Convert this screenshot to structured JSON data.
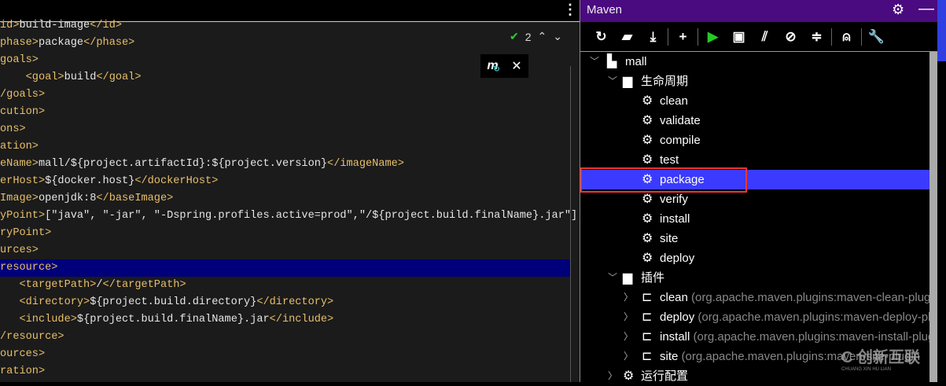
{
  "editor": {
    "inspection_count": "2",
    "code_lines": [
      [
        [
          "tag",
          "id>"
        ],
        [
          "text",
          "build-image"
        ],
        [
          "tag",
          "</id>"
        ]
      ],
      [
        [
          "tag",
          "phase>"
        ],
        [
          "text",
          "package"
        ],
        [
          "tag",
          "</phase>"
        ]
      ],
      [
        [
          "tag",
          "goals>"
        ]
      ],
      [
        [
          "tag",
          "    <goal>"
        ],
        [
          "text",
          "build"
        ],
        [
          "tag",
          "</goal>"
        ]
      ],
      [
        [
          "tag",
          "/goals>"
        ]
      ],
      [
        [
          "tag",
          "cution>"
        ]
      ],
      [
        [
          "tag",
          "ons>"
        ]
      ],
      [
        [
          "tag",
          "ation>"
        ]
      ],
      [
        [
          "tag",
          "eName>"
        ],
        [
          "text",
          "mall/${project.artifactId}:${project.version}"
        ],
        [
          "tag",
          "</imageName>"
        ]
      ],
      [
        [
          "tag",
          "erHost>"
        ],
        [
          "text",
          "${docker.host}"
        ],
        [
          "tag",
          "</dockerHost>"
        ]
      ],
      [
        [
          "tag",
          "Image>"
        ],
        [
          "text",
          "openjdk:8"
        ],
        [
          "tag",
          "</baseImage>"
        ]
      ],
      [
        [
          "tag",
          "yPoint>"
        ],
        [
          "text",
          "[\"java\", \"-jar\", \"-Dspring.profiles.active=prod\",\"/${project.build.finalName}.jar\"]"
        ]
      ],
      [
        [
          "tag",
          "ryPoint>"
        ]
      ],
      [
        [
          "tag",
          "urces>"
        ]
      ],
      [
        [
          "tag",
          "resource>"
        ]
      ],
      [
        [
          "tag",
          "   <targetPath>"
        ],
        [
          "text",
          "/"
        ],
        [
          "tag",
          "</targetPath>"
        ]
      ],
      [
        [
          "tag",
          "   <directory>"
        ],
        [
          "text",
          "${project.build.directory}"
        ],
        [
          "tag",
          "</directory>"
        ]
      ],
      [
        [
          "tag",
          "   <include>"
        ],
        [
          "text",
          "${project.build.finalName}.jar"
        ],
        [
          "tag",
          "</include>"
        ]
      ],
      [
        [
          "tag",
          "/resource>"
        ]
      ],
      [
        [
          "tag",
          "ources>"
        ]
      ],
      [
        [
          "tag",
          "ration>"
        ]
      ]
    ],
    "highlighted_line": 14
  },
  "maven": {
    "title": "Maven",
    "toolbar": [
      "reload-icon",
      "folder-sync-icon",
      "download-icon",
      "|",
      "add-icon",
      "|",
      "run-icon",
      "terminal-icon",
      "toggle-offline-icon",
      "skip-tests-icon",
      "collapse-icon",
      "|",
      "analyze-icon",
      "|",
      "wrench-icon"
    ],
    "tree": [
      {
        "level": 0,
        "arrow": "down",
        "icon": "maven-project-icon",
        "label": "mall"
      },
      {
        "level": 1,
        "arrow": "down",
        "icon": "folder-gear-icon",
        "label": "生命周期"
      },
      {
        "level": 2,
        "icon": "gear-icon",
        "label": "clean"
      },
      {
        "level": 2,
        "icon": "gear-icon",
        "label": "validate"
      },
      {
        "level": 2,
        "icon": "gear-icon",
        "label": "compile"
      },
      {
        "level": 2,
        "icon": "gear-icon",
        "label": "test"
      },
      {
        "level": 2,
        "icon": "gear-icon",
        "label": "package",
        "selected": true
      },
      {
        "level": 2,
        "icon": "gear-icon",
        "label": "verify"
      },
      {
        "level": 2,
        "icon": "gear-icon",
        "label": "install"
      },
      {
        "level": 2,
        "icon": "gear-icon",
        "label": "site"
      },
      {
        "level": 2,
        "icon": "gear-icon",
        "label": "deploy"
      },
      {
        "level": 1,
        "arrow": "down",
        "icon": "folder-gear-icon",
        "label": "插件"
      },
      {
        "level": 2,
        "arrow": "right",
        "icon": "plugin-icon",
        "label": "clean",
        "detail": "(org.apache.maven.plugins:maven-clean-plugin"
      },
      {
        "level": 2,
        "arrow": "right",
        "icon": "plugin-icon",
        "label": "deploy",
        "detail": "(org.apache.maven.plugins:maven-deploy-plugin"
      },
      {
        "level": 2,
        "arrow": "right",
        "icon": "plugin-icon",
        "label": "install",
        "detail": "(org.apache.maven.plugins:maven-install-plugin"
      },
      {
        "level": 2,
        "arrow": "right",
        "icon": "plugin-icon",
        "label": "site",
        "detail": "(org.apache.maven.plugins:maven-site-plugin"
      },
      {
        "level": 1,
        "arrow": "right",
        "icon": "gear-icon",
        "label": "运行配置"
      }
    ]
  },
  "watermark": {
    "text": "创新互联",
    "sub": "CHUANG XIN HU LIAN"
  },
  "colors": {
    "header": "#4a0a80",
    "selection": "#3b3bff",
    "tag": "#e8bf6a",
    "highlight_line": "#00007a"
  }
}
